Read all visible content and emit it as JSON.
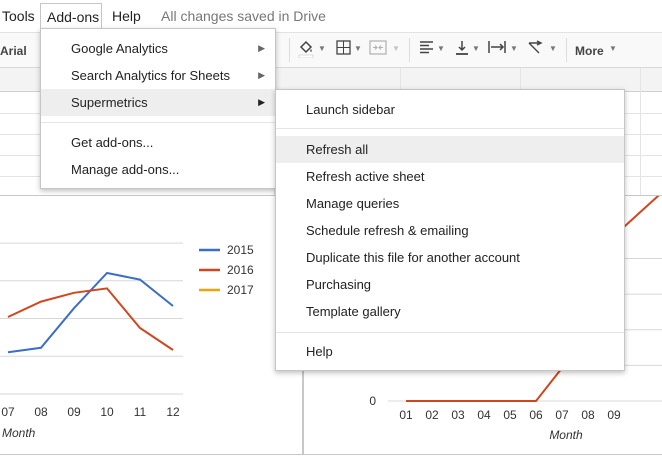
{
  "menubar": {
    "tools_label": "Tools",
    "addons_label": "Add-ons",
    "help_label": "Help",
    "saved_status": "All changes saved in Drive"
  },
  "toolbar": {
    "font_name": "Arial",
    "more_label": "More",
    "icons": [
      "fill-color-icon",
      "borders-icon",
      "merge-cells-icon",
      "horizontal-align-icon",
      "vertical-align-icon",
      "text-wrap-icon",
      "text-rotation-icon"
    ]
  },
  "addons_menu": {
    "items": [
      {
        "label": "Google Analytics",
        "submenu": true
      },
      {
        "label": "Search Analytics for Sheets",
        "submenu": true
      },
      {
        "label": "Supermetrics",
        "submenu": true,
        "highlighted": true
      },
      {
        "label": "Get add-ons...",
        "submenu": false
      },
      {
        "label": "Manage add-ons...",
        "submenu": false
      }
    ]
  },
  "supermetrics_menu": {
    "items": [
      {
        "label": "Launch sidebar"
      },
      {
        "label": "Refresh all",
        "highlighted": true
      },
      {
        "label": "Refresh active sheet"
      },
      {
        "label": "Manage queries"
      },
      {
        "label": "Schedule refresh & emailing"
      },
      {
        "label": "Duplicate this file for another account"
      },
      {
        "label": "Purchasing"
      },
      {
        "label": "Template gallery"
      },
      {
        "label": "Help"
      }
    ]
  },
  "colors": {
    "series_2015": "#3c6fc4",
    "series_2016": "#d0471e",
    "series_2017": "#f0a30a",
    "highlight": "#eeeeee"
  },
  "chart_data": [
    {
      "type": "line",
      "categories": [
        "07",
        "08",
        "09",
        "10",
        "11",
        "12"
      ],
      "xlabel": "Month",
      "legend_position": "right",
      "series": [
        {
          "name": "2015",
          "values": [
            0.38,
            0.42,
            0.78,
            1.1,
            1.04,
            0.8
          ]
        },
        {
          "name": "2016",
          "values": [
            0.7,
            0.84,
            0.92,
            0.96,
            0.6,
            0.4
          ]
        },
        {
          "name": "2017",
          "values": []
        }
      ]
    },
    {
      "type": "line",
      "categories": [
        "01",
        "02",
        "03",
        "04",
        "05",
        "06",
        "07",
        "08",
        "09"
      ],
      "xlabel": "Month",
      "ytick_visible": "0",
      "series": [
        {
          "name": "2016",
          "values": [
            0,
            0,
            0,
            0,
            0,
            0,
            0.1,
            0.42,
            0.5
          ]
        }
      ]
    }
  ]
}
